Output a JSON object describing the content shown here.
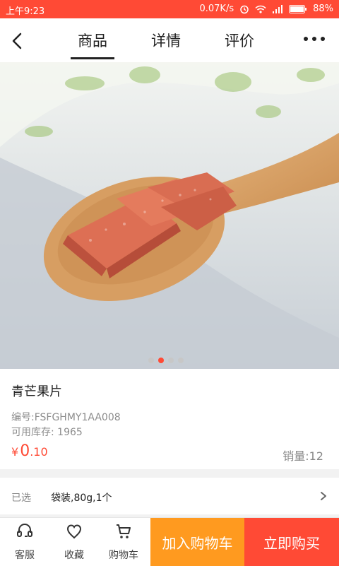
{
  "status": {
    "time": "上午9:23",
    "speed": "0.07K/s",
    "battery": "88%"
  },
  "header": {
    "tabs": [
      "商品",
      "详情",
      "评价"
    ]
  },
  "product": {
    "name": "青芒果片",
    "code": "编号:FSFGHMY1AA008",
    "stock": "可用库存: 1965",
    "price_symbol": "¥",
    "price_int": "0",
    "price_dec": ".10",
    "sales": "销量:12"
  },
  "carousel": {
    "active_index": 1,
    "count": 4
  },
  "spec": {
    "label": "已选",
    "value": "袋装,80g,1个"
  },
  "bottom": {
    "service": "客服",
    "favorite": "收藏",
    "cart": "购物车",
    "add_cart": "加入购物车",
    "buy_now": "立即购买"
  },
  "colors": {
    "accent": "#ff4a35",
    "orange": "#ff9a1f"
  }
}
